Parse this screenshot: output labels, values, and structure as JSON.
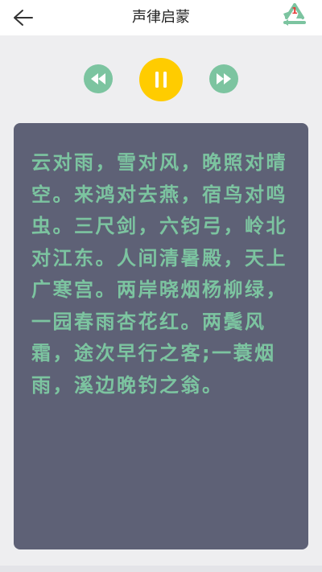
{
  "header": {
    "title": "声律启蒙",
    "badge_count": "1"
  },
  "icons": {
    "back": "arrow-left-icon",
    "recycle": "recycle-icon",
    "prev": "rewind-icon",
    "pause": "pause-icon",
    "next": "fast-forward-icon"
  },
  "colors": {
    "accent_green": "#7cc4a0",
    "play_yellow": "#ffcc00",
    "card_bg": "#5e6176",
    "badge_red": "#e53935"
  },
  "poem": {
    "text": "云对雨，雪对风，晚照对晴空。来鸿对去燕，宿鸟对鸣虫。三尺剑，六钧弓，岭北对江东。人间清暑殿，天上广寒宫。两岸晓烟杨柳绿，一园春雨杏花红。两鬓风霜，途次早行之客;一蓑烟雨，溪边晚钓之翁。"
  }
}
